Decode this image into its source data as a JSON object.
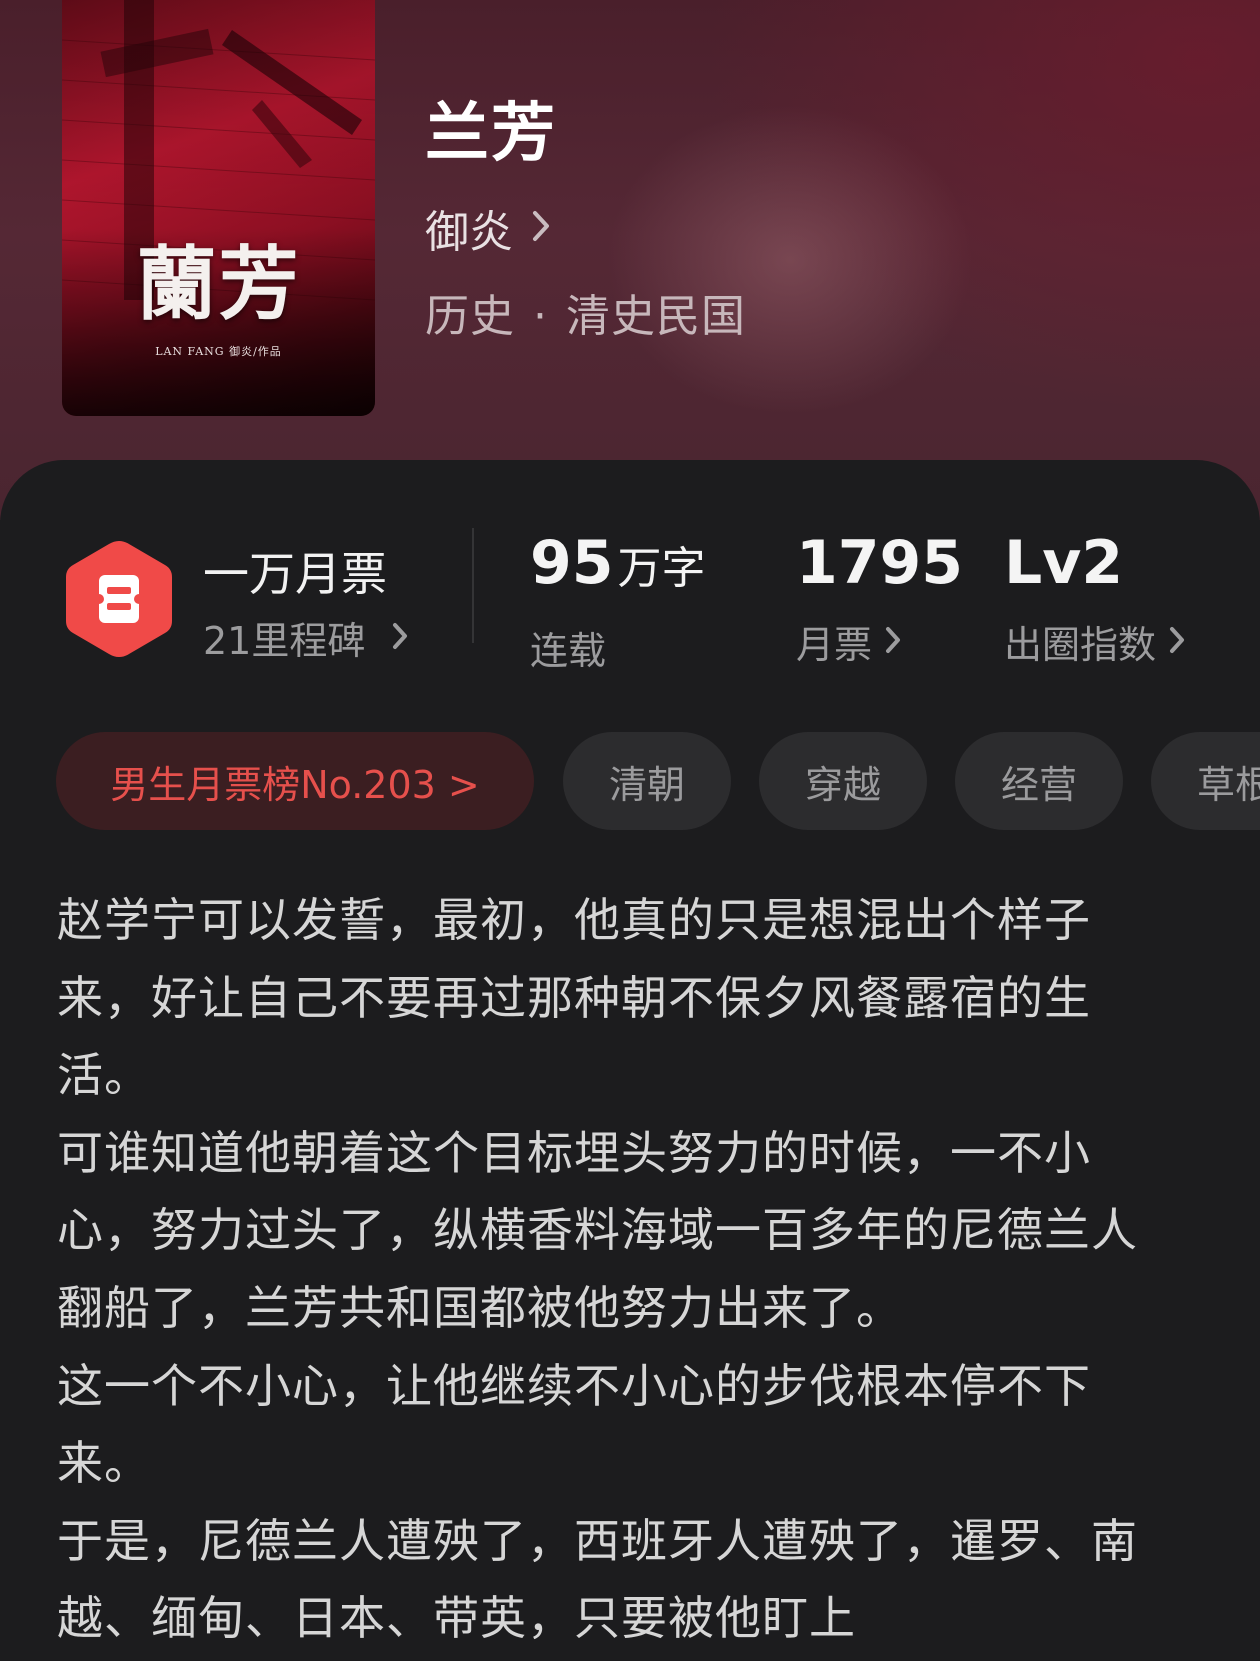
{
  "book": {
    "title": "兰芳",
    "author": "御炎",
    "genre": "历史",
    "subgenre": "清史民国",
    "genre_separator": "·",
    "cover": {
      "title": "蘭芳",
      "byline": "LAN FANG 御炎/作品"
    }
  },
  "ticket_badge": {
    "title": "一万月票",
    "subtitle": "21里程碑"
  },
  "stats": [
    {
      "value": "95",
      "unit": "万字",
      "label": "连载"
    },
    {
      "value": "1795",
      "unit": "",
      "label": "月票"
    },
    {
      "value": "Lv2",
      "unit": "",
      "label": "出圈指数"
    }
  ],
  "tags": {
    "rank": "男生月票榜No.203 >",
    "items": [
      "清朝",
      "穿越",
      "经营",
      "草根"
    ]
  },
  "description": [
    "赵学宁可以发誓，最初，他真的只是想混出个样子来，好让自己不要再过那种朝不保夕风餐露宿的生活。",
    "可谁知道他朝着这个目标埋头努力的时候，一不小心，努力过头了，纵横香料海域一百多年的尼德兰人翻船了，兰芳共和国都被他努力出来了。",
    "这一个不小心，让他继续不小心的步伐根本停不下来。",
    "于是，尼德兰人遭殃了，西班牙人遭殃了，暹罗、南越、缅甸、日本、带英，只要被他盯上"
  ],
  "colors": {
    "accent_red": "#e6504c",
    "badge_red": "#f04a48",
    "background": "#1c1c1e",
    "hero_tint": "#552835"
  },
  "icons": {
    "badge": "ticket-hexagon-icon",
    "chevron": "chevron-right-icon"
  }
}
